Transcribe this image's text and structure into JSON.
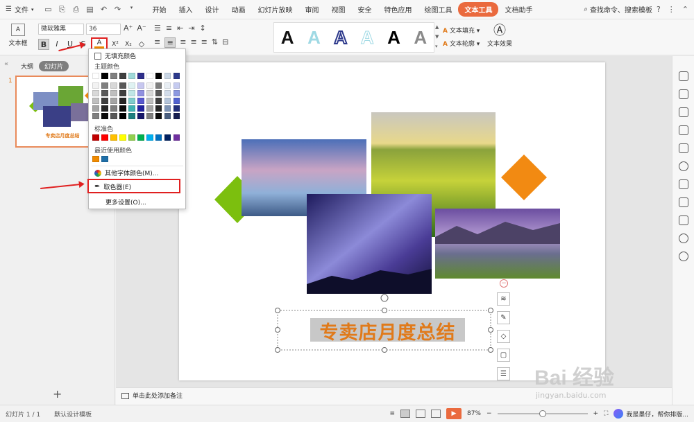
{
  "menubar": {
    "file_label": "文件",
    "tabs": [
      "开始",
      "插入",
      "设计",
      "动画",
      "幻灯片放映",
      "审阅",
      "视图",
      "安全",
      "特色应用",
      "绘图工具",
      "文本工具",
      "文档助手"
    ],
    "active_tab": "文本工具",
    "search_label": "查找命令、搜索模板",
    "help": "?"
  },
  "ribbon": {
    "textbox_label": "文本框",
    "textbox_icon": "A",
    "font_name": "微软雅黑",
    "font_size": "36",
    "bold": "B",
    "italic": "I",
    "underline": "U",
    "strike": "S",
    "font_color": "A",
    "superscript": "X²",
    "subscript": "X₂",
    "clear": "◇",
    "style_letter": "A",
    "text_fill": "文本填充",
    "text_outline": "文本轮廓",
    "text_effect": "文本效果"
  },
  "color_menu": {
    "no_fill": "无填充颜色",
    "theme_colors": "主题颜色",
    "standard_colors": "标准色",
    "recent_colors": "最近使用颜色",
    "more_colors": "其他字体颜色(M)...",
    "eyedropper": "取色器(E)",
    "more_settings": "更多设置(O)...",
    "theme_top_row": [
      "#ffffff",
      "#000000",
      "#7f7f7f",
      "#3f3f3f",
      "#9fd9d9",
      "#2e2e8a",
      "#ffffff",
      "#000000",
      "#c9d6e5",
      "#2d3a8c"
    ],
    "theme_shades": [
      [
        "#f2f2f2",
        "#7f7f7f",
        "#d8d8d8",
        "#595959",
        "#dff2f2",
        "#c7c7ef",
        "#f2f2f2",
        "#7f7f7f",
        "#e8eef4",
        "#c5cbf0"
      ],
      [
        "#d8d8d8",
        "#595959",
        "#bfbfbf",
        "#3f3f3f",
        "#bfe6e6",
        "#9090e0",
        "#d8d8d8",
        "#595959",
        "#d2dcea",
        "#8c98e0"
      ],
      [
        "#bfbfbf",
        "#3f3f3f",
        "#a5a5a5",
        "#262626",
        "#7fcccc",
        "#5858cf",
        "#bfbfbf",
        "#3f3f3f",
        "#b4c4da",
        "#5262cf"
      ],
      [
        "#a5a5a5",
        "#262626",
        "#7f7f7f",
        "#0c0c0c",
        "#3fb3b3",
        "#22229e",
        "#a5a5a5",
        "#262626",
        "#7d93b5",
        "#222e78"
      ],
      [
        "#7f7f7f",
        "#0c0c0c",
        "#595959",
        "#000000",
        "#1f7f7f",
        "#161669",
        "#7f7f7f",
        "#0c0c0c",
        "#4a5f80",
        "#161e50"
      ]
    ],
    "standard_row": [
      "#c00000",
      "#ff0000",
      "#ffc000",
      "#ffff00",
      "#92d050",
      "#00b050",
      "#00b0f0",
      "#0070c0",
      "#002060",
      "#7030a0"
    ],
    "recent_row": [
      "#f08a00",
      "#1f6fa8"
    ]
  },
  "left_panel": {
    "tab_outline": "大纲",
    "tab_slides": "幻灯片",
    "slide_number": "1",
    "thumb_title": "专卖店月度总结",
    "add_slide": "+"
  },
  "slide": {
    "title": "专卖店月度总结",
    "title_color": "#e07a1a",
    "green_shape": "#7cbf0e",
    "orange_shape": "#f28a12"
  },
  "notes": {
    "placeholder": "单击此处添加备注"
  },
  "status": {
    "slide_count": "幻灯片 1 / 1",
    "template": "默认设计模板",
    "zoom": "87%",
    "minus": "−",
    "plus": "+",
    "assistant": "我是墨仔，帮你排版..."
  },
  "watermark": {
    "brand": "Bai 经验",
    "url": "jingyan.baidu.com"
  },
  "accent": "#ea6a3e"
}
